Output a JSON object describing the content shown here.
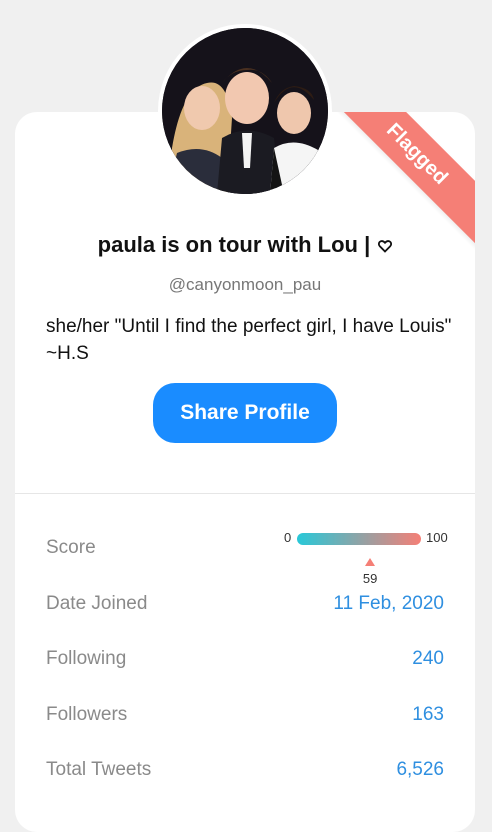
{
  "ribbon": {
    "label": "Flagged",
    "color": "#f57f76"
  },
  "profile": {
    "name": "paula is on tour with Lou |",
    "name_icon": "heart-outline-icon",
    "handle": "@canyonmoon_pau",
    "bio": "she/her \"Until I find the perfect girl, I have Louis\" ~H.S"
  },
  "share_button": {
    "label": "Share Profile",
    "color": "#1a8cff"
  },
  "stats": {
    "score": {
      "label": "Score",
      "min": "0",
      "max": "100",
      "value": 59,
      "value_text": "59"
    },
    "date_joined": {
      "label": "Date Joined",
      "value": "11 Feb, 2020"
    },
    "following": {
      "label": "Following",
      "value": "240"
    },
    "followers": {
      "label": "Followers",
      "value": "163"
    },
    "total_tweets": {
      "label": "Total Tweets",
      "value": "6,526"
    }
  },
  "colors": {
    "accent": "#2f8fe0",
    "score_gradient_start": "#28c8d8",
    "score_gradient_end": "#f57f76"
  }
}
